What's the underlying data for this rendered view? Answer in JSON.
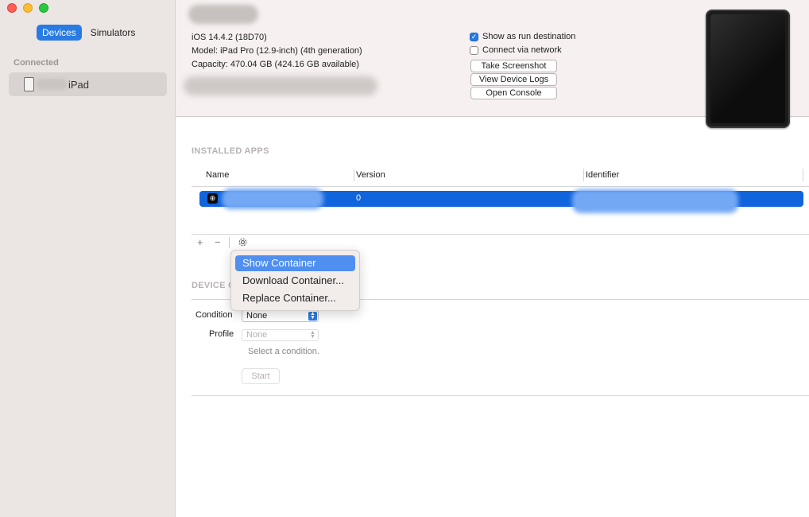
{
  "sidebar": {
    "tabs": [
      {
        "label": "Devices",
        "active": true
      },
      {
        "label": "Simulators",
        "active": false
      }
    ],
    "section_label": "Connected",
    "device": {
      "name_suffix": "iPad",
      "icon": "ipad-icon"
    }
  },
  "device_info": {
    "ios": "iOS 14.4.2 (18D70)",
    "model": "Model: iPad Pro (12.9-inch) (4th generation)",
    "capacity": "Capacity: 470.04 GB (424.16 GB available)",
    "show_as_run_destination": {
      "label": "Show as run destination",
      "checked": true
    },
    "connect_via_network": {
      "label": "Connect via network",
      "checked": false
    },
    "buttons": {
      "screenshot": "Take Screenshot",
      "logs": "View Device Logs",
      "console": "Open Console"
    }
  },
  "installed_apps": {
    "title": "INSTALLED APPS",
    "columns": {
      "name": "Name",
      "version": "Version",
      "identifier": "Identifier"
    },
    "rows": [
      {
        "version": "0",
        "selected": true
      }
    ]
  },
  "toolbar": {
    "add": "+",
    "remove": "−",
    "gear_icon": "gear-icon"
  },
  "context_menu": {
    "items": [
      {
        "label": "Show Container",
        "highlighted": true
      },
      {
        "label": "Download Container...",
        "highlighted": false
      },
      {
        "label": "Replace Container...",
        "highlighted": false
      }
    ]
  },
  "device_conditions": {
    "title": "DEVICE C",
    "condition_label": "Condition",
    "condition_value": "None",
    "profile_label": "Profile",
    "profile_value": "None",
    "hint": "Select a condition.",
    "start": "Start"
  },
  "colors": {
    "accent": "#2a7ae4",
    "selection": "#1064dc",
    "menu_highlight": "#4f8ff0",
    "sidebar_bg": "#ebe5e3"
  }
}
